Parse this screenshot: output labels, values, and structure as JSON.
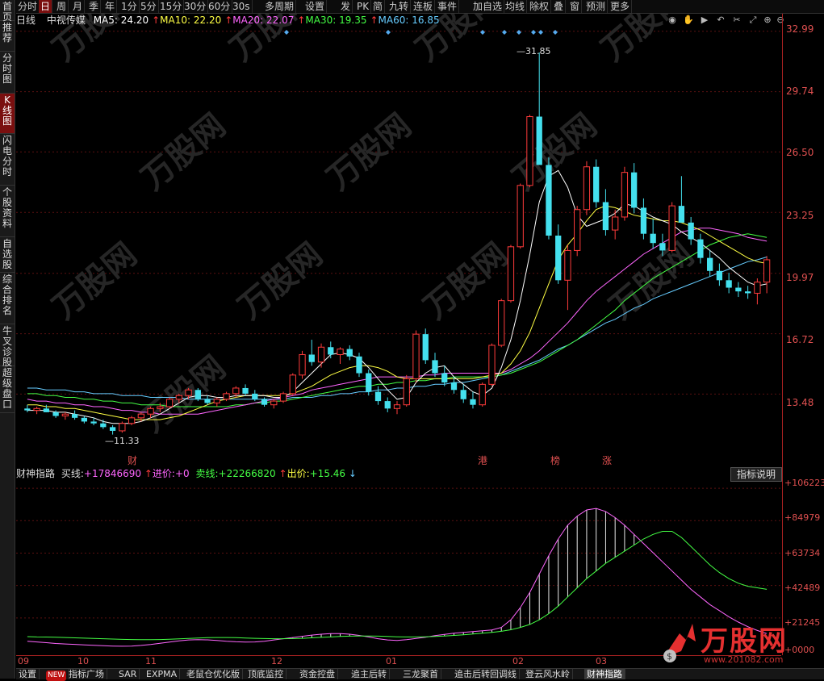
{
  "left_nav": [
    "首页",
    "推荐",
    "分时图",
    "K线图",
    "闪电分时",
    "个股资料",
    "自选股",
    "综合排名",
    "牛叉诊股",
    "超级盘口"
  ],
  "left_nav_active": 3,
  "toolbar": {
    "items": [
      "分时",
      "日",
      "周",
      "月",
      "季",
      "年",
      "1分",
      "5分",
      "15分",
      "30分",
      "60分",
      "30s",
      "多周期",
      "设置",
      "发",
      "PK",
      "简",
      "九转",
      "连板",
      "事件",
      "加自选",
      "均线",
      "除权",
      "叠",
      "窗",
      "预测",
      "更多"
    ],
    "active_index": 1
  },
  "main": {
    "period_label": "日线",
    "stock_name": "中视传媒",
    "ma_labels": [
      {
        "name": "MA5",
        "value": "24.20",
        "color": "#ffffff",
        "arrow": ""
      },
      {
        "name": "MA10",
        "value": "22.20",
        "color": "#ffff44",
        "arrow": "↑"
      },
      {
        "name": "MA20",
        "value": "22.07",
        "color": "#ff66ff",
        "arrow": "↑"
      },
      {
        "name": "MA30",
        "value": "19.35",
        "color": "#44ff44",
        "arrow": "↑"
      },
      {
        "name": "MA60",
        "value": "16.85",
        "color": "#66ccff",
        "arrow": "↑"
      }
    ],
    "high_label": "31.85",
    "low_label": "11.33",
    "events": [
      "财",
      "港",
      "榜",
      "涨"
    ],
    "y_ticks": [
      "32.99",
      "29.74",
      "26.50",
      "23.25",
      "19.97",
      "16.72",
      "13.48"
    ]
  },
  "indicator": {
    "name": "财神指路",
    "buy_line_label": "买线:",
    "buy_line_value": "+17846690",
    "enter_label": "进价:",
    "enter_value": "+0",
    "sell_line_label": "卖线:",
    "sell_line_value": "+22266820",
    "exit_label": "出价:",
    "exit_value": "+15.46",
    "explain_button": "指标说明",
    "y_ticks": [
      "+106223",
      "+84979",
      "+63734",
      "+42489",
      "+21245",
      "+0000"
    ]
  },
  "dates": [
    "09",
    "10",
    "11",
    "12",
    "01",
    "02",
    "03"
  ],
  "bottom_tabs": [
    "设置",
    "NEW",
    "指标广场",
    "SAR",
    "EXPMA",
    "老鼠仓优化版",
    "顶底监控",
    "资金控盘",
    "追主后转",
    "三龙聚首",
    "追击后转回调线",
    "登云风水岭",
    "财神指路"
  ],
  "bottom_active": 12,
  "watermark": "万股网",
  "logo": {
    "text": "万股网",
    "url": "www.201082.com"
  },
  "colors": {
    "up": "#ff3b3b",
    "down": "#44e0ee",
    "axis": "#aa2222"
  },
  "chart_data": {
    "type": "candlestick",
    "title": "中视传媒 日线",
    "ylim": [
      10.5,
      33.5
    ],
    "candles": [
      [
        12.7,
        12.9,
        12.5,
        12.6
      ],
      [
        12.6,
        12.8,
        12.4,
        12.7
      ],
      [
        12.7,
        12.9,
        12.5,
        12.5
      ],
      [
        12.5,
        12.6,
        12.2,
        12.3
      ],
      [
        12.3,
        12.5,
        12.1,
        12.4
      ],
      [
        12.4,
        12.6,
        12.1,
        12.2
      ],
      [
        12.2,
        12.3,
        11.9,
        12.0
      ],
      [
        12.0,
        12.2,
        11.8,
        11.9
      ],
      [
        11.9,
        12.1,
        11.6,
        11.7
      ],
      [
        11.7,
        11.8,
        11.3,
        11.5
      ],
      [
        11.5,
        12.0,
        11.4,
        11.9
      ],
      [
        11.9,
        12.3,
        11.8,
        12.2
      ],
      [
        12.2,
        12.5,
        12.0,
        12.4
      ],
      [
        12.4,
        12.8,
        12.2,
        12.7
      ],
      [
        12.7,
        13.0,
        12.5,
        12.8
      ],
      [
        12.8,
        13.3,
        12.7,
        13.2
      ],
      [
        13.2,
        13.5,
        13.0,
        13.4
      ],
      [
        13.4,
        13.8,
        13.2,
        13.7
      ],
      [
        13.7,
        13.8,
        13.1,
        13.2
      ],
      [
        13.2,
        13.4,
        12.9,
        13.0
      ],
      [
        13.0,
        13.3,
        12.8,
        13.2
      ],
      [
        13.2,
        13.6,
        13.1,
        13.5
      ],
      [
        13.5,
        13.9,
        13.3,
        13.8
      ],
      [
        13.8,
        14.0,
        13.4,
        13.5
      ],
      [
        13.5,
        13.7,
        13.1,
        13.2
      ],
      [
        13.2,
        13.3,
        12.8,
        12.9
      ],
      [
        12.9,
        13.2,
        12.7,
        13.1
      ],
      [
        13.1,
        13.6,
        13.0,
        13.5
      ],
      [
        13.5,
        14.6,
        13.4,
        14.5
      ],
      [
        14.5,
        15.8,
        14.3,
        15.6
      ],
      [
        15.6,
        16.4,
        15.0,
        15.2
      ],
      [
        15.2,
        16.2,
        14.9,
        16.0
      ],
      [
        16.0,
        16.3,
        15.4,
        15.6
      ],
      [
        15.6,
        16.0,
        15.1,
        15.9
      ],
      [
        15.9,
        16.1,
        15.3,
        15.5
      ],
      [
        15.5,
        15.7,
        14.4,
        14.6
      ],
      [
        14.6,
        14.8,
        13.4,
        13.6
      ],
      [
        13.6,
        13.9,
        12.9,
        13.1
      ],
      [
        13.1,
        13.3,
        12.5,
        12.7
      ],
      [
        12.7,
        13.1,
        12.4,
        12.9
      ],
      [
        12.9,
        14.5,
        12.8,
        14.3
      ],
      [
        14.3,
        16.9,
        14.1,
        16.7
      ],
      [
        16.7,
        17.0,
        15.1,
        15.3
      ],
      [
        15.3,
        15.7,
        14.4,
        14.6
      ],
      [
        14.6,
        15.0,
        13.9,
        14.1
      ],
      [
        14.1,
        14.4,
        13.5,
        13.7
      ],
      [
        13.7,
        14.0,
        13.0,
        13.2
      ],
      [
        13.2,
        13.6,
        12.7,
        12.9
      ],
      [
        12.9,
        14.1,
        12.8,
        14.0
      ],
      [
        14.0,
        16.2,
        13.9,
        16.1
      ],
      [
        16.1,
        18.6,
        16.0,
        18.5
      ],
      [
        18.5,
        21.5,
        18.4,
        21.4
      ],
      [
        21.4,
        24.8,
        21.3,
        24.7
      ],
      [
        24.7,
        28.5,
        24.6,
        28.4
      ],
      [
        28.4,
        31.85,
        27.8,
        25.8
      ],
      [
        25.8,
        26.2,
        21.8,
        22.0
      ],
      [
        22.0,
        22.6,
        19.4,
        19.6
      ],
      [
        19.6,
        21.5,
        18.0,
        21.2
      ],
      [
        21.2,
        23.6,
        20.9,
        23.4
      ],
      [
        23.4,
        26.0,
        23.1,
        25.7
      ],
      [
        25.7,
        26.1,
        23.5,
        23.8
      ],
      [
        23.8,
        24.5,
        22.0,
        22.3
      ],
      [
        22.3,
        23.4,
        21.8,
        23.0
      ],
      [
        23.0,
        25.7,
        22.8,
        25.4
      ],
      [
        25.4,
        25.9,
        23.2,
        23.5
      ],
      [
        23.5,
        24.0,
        21.8,
        22.1
      ],
      [
        22.1,
        22.9,
        21.3,
        21.6
      ],
      [
        21.6,
        22.1,
        20.9,
        21.2
      ],
      [
        21.2,
        23.8,
        21.1,
        23.6
      ],
      [
        23.6,
        25.2,
        23.0,
        22.7
      ],
      [
        22.7,
        23.0,
        21.5,
        21.8
      ],
      [
        21.8,
        22.1,
        20.5,
        20.8
      ],
      [
        20.8,
        21.2,
        19.8,
        20.1
      ],
      [
        20.1,
        20.5,
        19.3,
        19.6
      ],
      [
        19.6,
        20.0,
        18.9,
        19.2
      ],
      [
        19.2,
        19.5,
        18.7,
        19.0
      ],
      [
        19.0,
        19.3,
        18.6,
        18.9
      ],
      [
        18.9,
        19.7,
        18.3,
        19.5
      ],
      [
        19.5,
        20.9,
        18.9,
        20.7
      ]
    ],
    "ma5": [
      12.6,
      12.6,
      12.6,
      12.5,
      12.5,
      12.4,
      12.3,
      12.2,
      12.0,
      11.9,
      11.9,
      11.9,
      12.0,
      12.2,
      12.4,
      12.7,
      13.0,
      13.3,
      13.4,
      13.4,
      13.3,
      13.3,
      13.4,
      13.4,
      13.4,
      13.4,
      13.3,
      13.3,
      13.6,
      14.1,
      14.6,
      15.1,
      15.6,
      15.7,
      15.6,
      15.4,
      14.9,
      14.3,
      13.7,
      13.2,
      13.3,
      14.1,
      14.6,
      14.9,
      15.0,
      14.4,
      14.0,
      13.6,
      13.4,
      13.8,
      14.9,
      16.4,
      18.5,
      21.0,
      23.8,
      25.2,
      25.5,
      24.6,
      23.1,
      22.5,
      22.7,
      22.9,
      23.2,
      23.7,
      23.6,
      23.3,
      23.0,
      22.8,
      22.6,
      22.2,
      21.9,
      21.6,
      21.2,
      20.8,
      20.3,
      19.9,
      19.5,
      19.3,
      19.4
    ],
    "ma10": [
      12.9,
      12.9,
      12.8,
      12.8,
      12.7,
      12.7,
      12.6,
      12.5,
      12.4,
      12.3,
      12.2,
      12.1,
      12.1,
      12.1,
      12.1,
      12.2,
      12.3,
      12.5,
      12.7,
      12.9,
      13.1,
      13.2,
      13.3,
      13.4,
      13.4,
      13.4,
      13.4,
      13.4,
      13.5,
      13.7,
      13.9,
      14.2,
      14.5,
      14.7,
      14.9,
      15.0,
      15.0,
      14.9,
      14.7,
      14.4,
      14.3,
      14.3,
      14.3,
      14.3,
      14.3,
      14.3,
      14.3,
      14.3,
      14.4,
      14.5,
      14.6,
      15.1,
      15.8,
      16.8,
      18.1,
      19.4,
      20.7,
      21.5,
      22.1,
      22.8,
      23.4,
      23.6,
      23.5,
      23.3,
      23.1,
      23.0,
      22.9,
      22.8,
      22.8,
      22.7,
      22.5,
      22.3,
      22.0,
      21.7,
      21.4,
      21.1,
      20.8,
      20.6,
      20.5
    ],
    "ma20": [
      13.2,
      13.1,
      13.1,
      13.0,
      13.0,
      12.9,
      12.9,
      12.8,
      12.8,
      12.7,
      12.6,
      12.6,
      12.5,
      12.5,
      12.4,
      12.4,
      12.4,
      12.4,
      12.4,
      12.5,
      12.6,
      12.7,
      12.8,
      12.9,
      13.0,
      13.1,
      13.2,
      13.3,
      13.4,
      13.5,
      13.7,
      13.8,
      13.9,
      14.0,
      14.1,
      14.2,
      14.3,
      14.4,
      14.4,
      14.4,
      14.4,
      14.4,
      14.5,
      14.5,
      14.6,
      14.6,
      14.6,
      14.6,
      14.6,
      14.6,
      14.6,
      14.8,
      15.1,
      15.4,
      15.8,
      16.3,
      16.8,
      17.3,
      17.9,
      18.5,
      19.0,
      19.4,
      19.8,
      20.2,
      20.6,
      21.0,
      21.3,
      21.6,
      21.9,
      22.2,
      22.3,
      22.4,
      22.4,
      22.3,
      22.2,
      22.1,
      21.9,
      21.8,
      21.7
    ],
    "ma30": [
      13.5,
      13.5,
      13.4,
      13.4,
      13.3,
      13.3,
      13.2,
      13.2,
      13.1,
      13.1,
      13.0,
      13.0,
      12.9,
      12.9,
      12.9,
      12.8,
      12.8,
      12.8,
      12.8,
      12.8,
      12.8,
      12.8,
      12.9,
      12.9,
      13.0,
      13.0,
      13.1,
      13.1,
      13.2,
      13.3,
      13.4,
      13.5,
      13.6,
      13.7,
      13.8,
      13.9,
      13.9,
      14.0,
      14.0,
      14.1,
      14.1,
      14.2,
      14.2,
      14.3,
      14.3,
      14.4,
      14.4,
      14.4,
      14.4,
      14.4,
      14.5,
      14.6,
      14.8,
      15.0,
      15.2,
      15.5,
      15.8,
      16.1,
      16.4,
      16.8,
      17.2,
      17.6,
      18.0,
      18.5,
      18.9,
      19.3,
      19.7,
      20.0,
      20.3,
      20.6,
      20.9,
      21.2,
      21.5,
      21.7,
      21.9,
      22.0,
      22.1,
      22.0,
      21.9
    ],
    "ma60": [
      13.8,
      13.8,
      13.7,
      13.7,
      13.7,
      13.6,
      13.6,
      13.5,
      13.5,
      13.5,
      13.4,
      13.4,
      13.4,
      13.3,
      13.3,
      13.3,
      13.3,
      13.2,
      13.2,
      13.2,
      13.2,
      13.2,
      13.2,
      13.2,
      13.2,
      13.2,
      13.2,
      13.2,
      13.3,
      13.3,
      13.3,
      13.4,
      13.4,
      13.5,
      13.5,
      13.6,
      13.6,
      13.7,
      13.7,
      13.8,
      13.8,
      13.9,
      13.9,
      14.0,
      14.0,
      14.1,
      14.1,
      14.2,
      14.3,
      14.4,
      14.5,
      14.7,
      14.9,
      15.1,
      15.3,
      15.6,
      15.9,
      16.1,
      16.4,
      16.7,
      17.0,
      17.3,
      17.5,
      17.8,
      18.1,
      18.3,
      18.6,
      18.8,
      19.0,
      19.2,
      19.4,
      19.6,
      19.8,
      20.0,
      20.2,
      20.4,
      20.6,
      20.7,
      20.85
    ],
    "indicator": {
      "ylim": [
        0,
        110000
      ],
      "buy": [
        6000,
        5500,
        5000,
        4500,
        4200,
        3900,
        3600,
        3300,
        3000,
        2800,
        2700,
        2800,
        3200,
        3800,
        4600,
        5400,
        6200,
        6800,
        7000,
        6900,
        6500,
        6000,
        5600,
        5400,
        5500,
        6000,
        6800,
        7600,
        8400,
        9200,
        10000,
        10600,
        11000,
        11000,
        10600,
        9800,
        8800,
        7600,
        6800,
        6500,
        7000,
        7800,
        8600,
        9600,
        10400,
        11200,
        11800,
        12300,
        12800,
        13400,
        15000,
        20000,
        28000,
        38000,
        50000,
        62000,
        73000,
        82000,
        88000,
        92000,
        93000,
        91000,
        87000,
        82000,
        76000,
        70000,
        64000,
        58000,
        52000,
        46000,
        40000,
        35000,
        30000,
        26000,
        22000,
        18500,
        15500,
        13000,
        11000
      ],
      "sell": [
        9000,
        8800,
        8700,
        8600,
        8400,
        8200,
        8000,
        7800,
        7600,
        7400,
        7200,
        7100,
        7000,
        7000,
        7100,
        7300,
        7500,
        7800,
        8100,
        8300,
        8400,
        8400,
        8300,
        8100,
        7900,
        7700,
        7600,
        7600,
        7700,
        7900,
        8200,
        8500,
        8800,
        9100,
        9300,
        9400,
        9400,
        9300,
        9100,
        8900,
        8800,
        8800,
        8900,
        9100,
        9400,
        9800,
        10200,
        10700,
        11200,
        11800,
        12500,
        13500,
        15000,
        17000,
        20000,
        24000,
        29000,
        35000,
        41000,
        47000,
        52000,
        57000,
        61000,
        65000,
        69000,
        73000,
        76000,
        78000,
        78000,
        74000,
        68000,
        62000,
        56000,
        51000,
        47000,
        44000,
        42000,
        41000,
        40000
      ]
    }
  }
}
